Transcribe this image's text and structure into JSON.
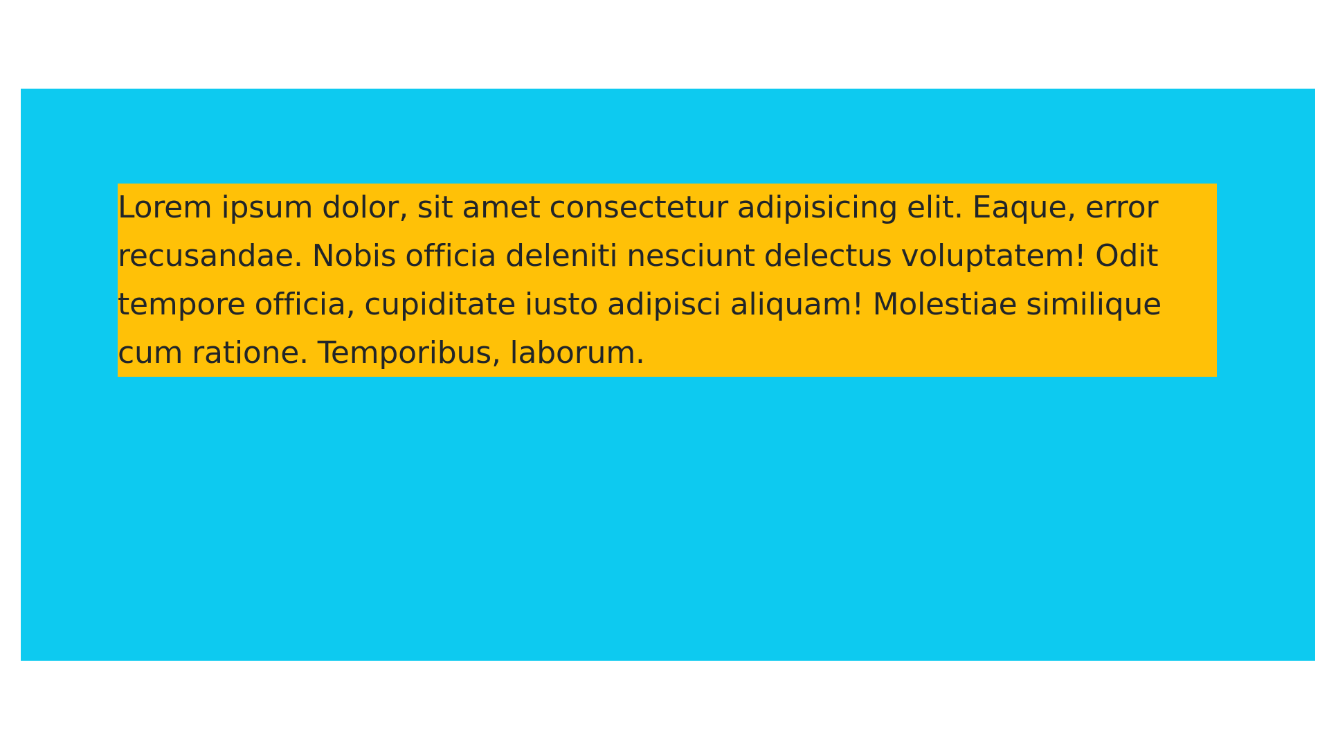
{
  "content": {
    "paragraph": "Lorem ipsum dolor, sit amet consectetur adipisicing elit. Eaque, error recusandae. Nobis officia deleniti nesciunt delectus voluptatem! Odit tempore officia, cupiditate iusto adipisci aliquam! Molestiae similique cum ratione. Temporibus, laborum."
  },
  "colors": {
    "outer_background": "#0dcaf0",
    "inner_background": "#ffc107",
    "text": "#212529",
    "page_background": "#ffffff"
  }
}
